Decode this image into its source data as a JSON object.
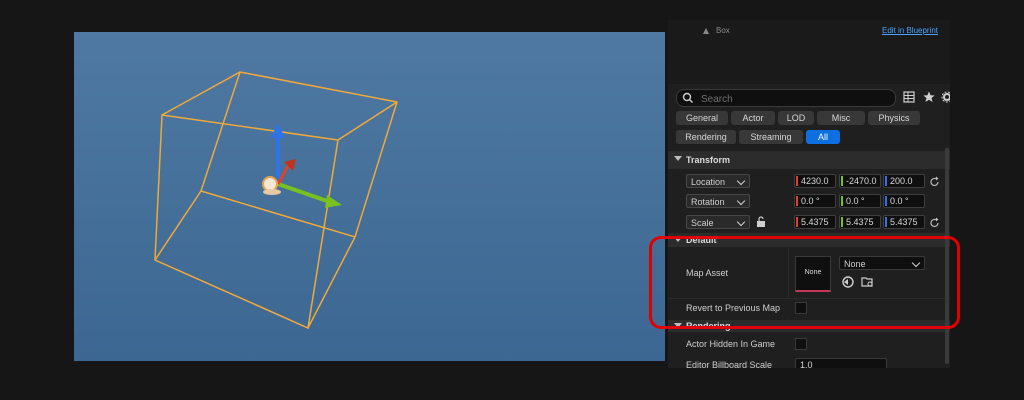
{
  "viewport": {},
  "details_panel": {
    "component_label": "Box",
    "edit_blueprint_label": "Edit in Blueprint",
    "search": {
      "placeholder": "Search"
    },
    "tabs": [
      {
        "label": "General",
        "active": false
      },
      {
        "label": "Actor",
        "active": false
      },
      {
        "label": "LOD",
        "active": false
      },
      {
        "label": "Misc",
        "active": false
      },
      {
        "label": "Physics",
        "active": false
      },
      {
        "label": "Rendering",
        "active": false
      },
      {
        "label": "Streaming",
        "active": false
      },
      {
        "label": "All",
        "active": true
      }
    ],
    "transform": {
      "title": "Transform",
      "location": {
        "label": "Location",
        "x": "4230.0",
        "y": "-2470.0",
        "z": "200.0"
      },
      "rotation": {
        "label": "Rotation",
        "x": "0.0 °",
        "y": "0.0 °",
        "z": "0.0 °"
      },
      "scale": {
        "label": "Scale",
        "x": "5.4375",
        "y": "5.4375",
        "z": "5.4375"
      }
    },
    "default": {
      "title": "Default",
      "map_asset": {
        "label": "Map Asset",
        "thumbnail": "None",
        "value": "None"
      },
      "revert_to_previous_map": {
        "label": "Revert to Previous Map"
      }
    },
    "rendering": {
      "title": "Rendering",
      "actor_hidden_in_game": {
        "label": "Actor Hidden In Game"
      },
      "editor_billboard_scale": {
        "label": "Editor Billboard Scale",
        "value": "1.0"
      }
    }
  },
  "colors": {
    "x_axis": "#e0422b",
    "y_axis": "#79c11f",
    "z_axis": "#2f73e8",
    "selection": "#f0a93a",
    "active_tab": "#0e6fe0",
    "highlight": "#e10000"
  }
}
